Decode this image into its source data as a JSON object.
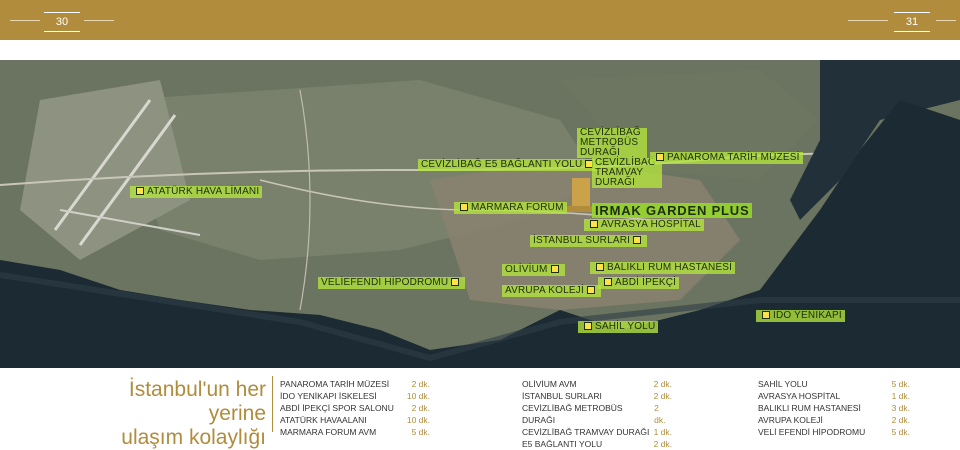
{
  "header": {
    "page_left": "30",
    "page_right": "31"
  },
  "map_labels": {
    "ataturk": "ATATÜRK HAVA LİMANI",
    "cevizlibag_e5": "CEVİZLİBAĞ E5 BAĞLANTI YOLU",
    "metrobus": "CEVİZLİBAĞ METROBÜS DURAĞI",
    "tramvay": "CEVİZLİBAĞ TRAMVAY DURAĞI",
    "panorama": "PANAROMA TARİH MÜZESİ",
    "marmara": "MARMARA FORUM",
    "irmak": "IRMAK GARDEN PLUS",
    "avrasya": "AVRASYA HOSPİTAL",
    "istanbul_surlari": "İSTANBUL SURLARI",
    "veliefendi": "VELİEFENDİ HİPODROMU",
    "olivium": "OLİVİUM",
    "balikli": "BALIKLI RUM HASTANESİ",
    "abdi": "ABDİ İPEKÇİ",
    "avrupa": "AVRUPA KOLEJİ",
    "ido": "İDO YENİKAPI",
    "sahil": "SAHİL YOLU"
  },
  "tagline": {
    "line1": "İstanbul'un her yerine",
    "line2": "ulaşım kolaylığı"
  },
  "distances": {
    "col1": [
      {
        "place": "PANAROMA TARİH MÜZESİ",
        "time": "2 dk."
      },
      {
        "place": "İDO YENİKAPI İSKELESİ",
        "time": "10 dk."
      },
      {
        "place": "ABDİ İPEKÇİ SPOR SALONU",
        "time": "2 dk."
      },
      {
        "place": "ATATÜRK HAVAALANI",
        "time": "10 dk."
      },
      {
        "place": "MARMARA FORUM AVM",
        "time": "5 dk."
      }
    ],
    "col2": [
      {
        "place": "OLİVİUM AVM",
        "time": "2 dk."
      },
      {
        "place": "İSTANBUL SURLARI",
        "time": "2 dk."
      },
      {
        "place": "CEVİZLİBAĞ METROBÜS DURAĞI",
        "time": "2 dk."
      },
      {
        "place": "CEVİZLİBAĞ TRAMVAY DURAĞI",
        "time": "1 dk."
      },
      {
        "place": "E5 BAĞLANTI YOLU",
        "time": "2 dk."
      }
    ],
    "col3": [
      {
        "place": "SAHİL YOLU",
        "time": "5 dk."
      },
      {
        "place": "AVRASYA HOSPİTAL",
        "time": "1 dk."
      },
      {
        "place": "BALIKLI RUM HASTANESİ",
        "time": "3 dk."
      },
      {
        "place": "AVRUPA KOLEJİ",
        "time": "2 dk."
      },
      {
        "place": "VELİ EFENDİ HİPODROMU",
        "time": "5 dk."
      }
    ]
  }
}
